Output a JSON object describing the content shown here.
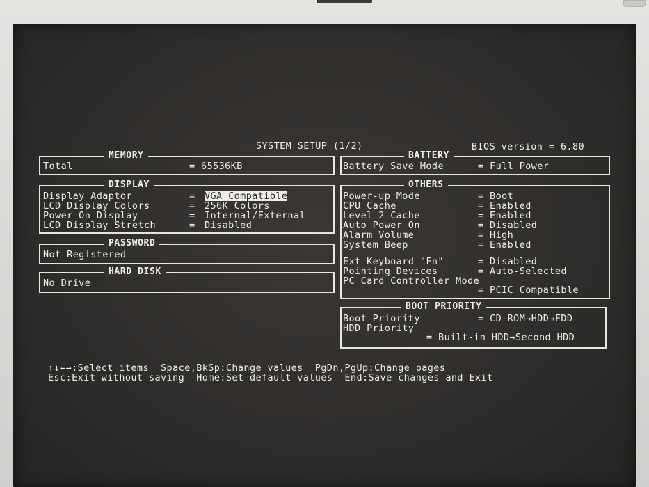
{
  "header": {
    "title": "SYSTEM SETUP (1/2)",
    "bios_version": "BIOS version = 6.80"
  },
  "memory": {
    "title": "MEMORY",
    "rows": [
      {
        "label": "Total",
        "value": "= 65536KB"
      }
    ]
  },
  "display": {
    "title": "DISPLAY",
    "rows": [
      {
        "label": "Display Adaptor",
        "eq": "=",
        "value": "VGA Compatible"
      },
      {
        "label": "LCD Display Colors",
        "eq": "=",
        "value": "256K Colors"
      },
      {
        "label": "Power On Display",
        "eq": "=",
        "value": "Internal/External"
      },
      {
        "label": "LCD Display Stretch",
        "eq": "=",
        "value": "Disabled"
      }
    ]
  },
  "password": {
    "title": "PASSWORD",
    "value": "Not Registered"
  },
  "hard_disk": {
    "title": "HARD DISK",
    "value": "No Drive"
  },
  "battery": {
    "title": "BATTERY",
    "rows": [
      {
        "label": "Battery Save Mode",
        "value": "= Full Power"
      }
    ]
  },
  "others": {
    "title": "OTHERS",
    "rows": [
      {
        "label": "Power-up Mode",
        "value": "= Boot"
      },
      {
        "label": "CPU Cache",
        "value": "= Enabled"
      },
      {
        "label": "Level 2 Cache",
        "value": "= Enabled"
      },
      {
        "label": "Auto Power On",
        "value": "= Disabled"
      },
      {
        "label": "Alarm Volume",
        "value": "= High"
      },
      {
        "label": "System Beep",
        "value": "= Enabled"
      },
      {
        "label": "Ext Keyboard \"Fn\"",
        "value": "= Disabled"
      },
      {
        "label": "Pointing Devices",
        "value": "= Auto-Selected"
      },
      {
        "label": "PC Card Controller Mode",
        "value": ""
      },
      {
        "label": "",
        "value": "= PCIC Compatible"
      }
    ]
  },
  "boot_priority": {
    "title": "BOOT PRIORITY",
    "boot_label": "Boot Priority",
    "boot_value": "= CD-ROM→HDD→FDD",
    "hdd_label": "HDD Priority",
    "hdd_value": "= Built-in HDD→Second HDD"
  },
  "help": {
    "line1": "↑↓←→:Select items  Space,BkSp:Change values  PgDn,PgUp:Change pages",
    "line2": "Esc:Exit without saving  Home:Set default values  End:Save changes and Exit"
  }
}
